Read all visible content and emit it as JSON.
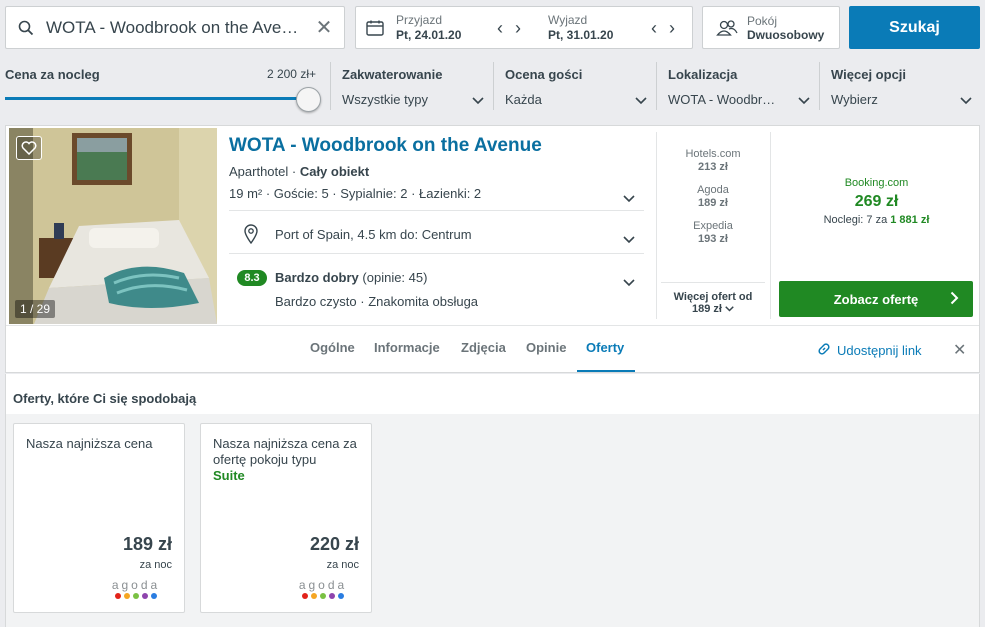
{
  "search": {
    "query": "WOTA - Woodbrook on the Avenu…",
    "checkin_label": "Przyjazd",
    "checkin_value": "Pt, 24.01.20",
    "checkout_label": "Wyjazd",
    "checkout_value": "Pt, 31.01.20",
    "rooms_label": "Pokój",
    "rooms_value": "Dwuosobowy",
    "submit_label": "Szukaj"
  },
  "filters": {
    "price_label": "Cena za nocleg",
    "price_max": "2 200 zł+",
    "price_level_percent": 100,
    "accommodation_label": "Zakwaterowanie",
    "accommodation_value": "Wszystkie typy",
    "rating_label": "Ocena gości",
    "rating_value": "Każda",
    "location_label": "Lokalizacja",
    "location_value": "WOTA - Woodbr…",
    "more_label": "Więcej opcji",
    "more_value": "Wybierz"
  },
  "hotel": {
    "photo_counter": "1 / 29",
    "name": "WOTA - Woodbrook on the Avenue",
    "type": "Aparthotel · ",
    "type_bold": "Cały obiekt",
    "specs": "19 m² · Goście: 5 · Sypialnie: 2 · Łazienki: 2",
    "location": "Port of Spain, 4.5 km do: Centrum",
    "rating_score": "8.3",
    "rating_word": "Bardzo dobry",
    "rating_count": " (opinie: 45)",
    "rating_highlights": "Bardzo czysto · Znakomita obsługa",
    "offers": [
      {
        "provider": "Hotels.com",
        "price": "213 zł"
      },
      {
        "provider": "Agoda",
        "price": "189 zł"
      },
      {
        "provider": "Expedia",
        "price": "193 zł"
      }
    ],
    "more_offers_label": "Więcej ofert od",
    "more_offers_price": "189 zł",
    "best_provider": "Booking.com",
    "best_price": "269 zł",
    "nights_text": "Noclegi: 7 za ",
    "nights_total": "1 881 zł",
    "deal_button": "Zobacz ofertę"
  },
  "tabs": [
    {
      "label": "Ogólne"
    },
    {
      "label": "Informacje"
    },
    {
      "label": "Zdjęcia"
    },
    {
      "label": "Opinie"
    },
    {
      "label": "Oferty"
    }
  ],
  "share_label": "Udostępnij link",
  "deals": {
    "title": "Oferty, które Ci się spodobają",
    "cards": [
      {
        "desc": "Nasza najniższa cena",
        "highlight": "",
        "price": "189 zł",
        "per": "za noc",
        "logo": "agoda"
      },
      {
        "desc": "Nasza najniższa cena za ofertę pokoju typu",
        "highlight": "Suite",
        "price": "220 zł",
        "per": "za noc",
        "logo": "agoda"
      }
    ]
  },
  "colors": {
    "brand_blue": "#0a7bb7",
    "green": "#208923"
  }
}
